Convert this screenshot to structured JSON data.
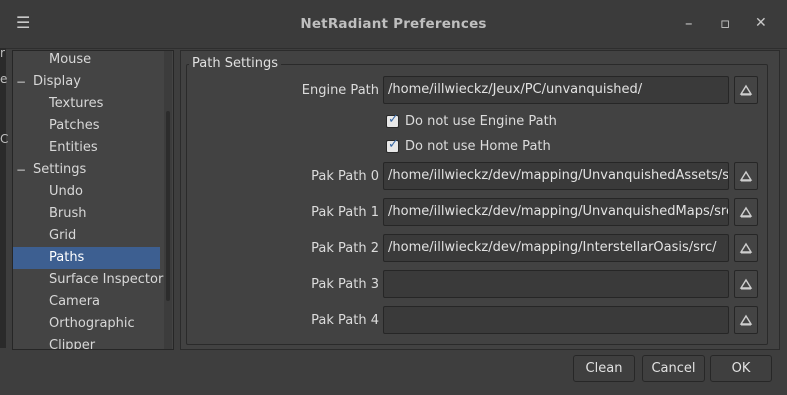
{
  "window": {
    "title": "NetRadiant Preferences",
    "icons": {
      "menu": "menu-icon",
      "minimize": "minimize-icon",
      "maximize": "maximize-icon",
      "close": "close-icon"
    }
  },
  "tree": {
    "items": [
      {
        "label": "Mouse",
        "level": "child"
      },
      {
        "label": "Display",
        "level": "parent",
        "expander": "−"
      },
      {
        "label": "Textures",
        "level": "child"
      },
      {
        "label": "Patches",
        "level": "child"
      },
      {
        "label": "Entities",
        "level": "child"
      },
      {
        "label": "Settings",
        "level": "parent",
        "expander": "−"
      },
      {
        "label": "Undo",
        "level": "child"
      },
      {
        "label": "Brush",
        "level": "child"
      },
      {
        "label": "Grid",
        "level": "child"
      },
      {
        "label": "Paths",
        "level": "child",
        "selected": true
      },
      {
        "label": "Surface Inspector",
        "level": "child"
      },
      {
        "label": "Camera",
        "level": "child"
      },
      {
        "label": "Orthographic",
        "level": "child"
      },
      {
        "label": "Clipper",
        "level": "child"
      }
    ],
    "selected_color": "#3d5f91"
  },
  "path_settings": {
    "legend": "Path Settings",
    "engine_path": {
      "label": "Engine Path",
      "value": "/home/illwieckz/Jeux/PC/unvanquished/"
    },
    "checkboxes": [
      {
        "label": "Do not use Engine Path",
        "checked": true
      },
      {
        "label": "Do not use Home Path",
        "checked": true
      }
    ],
    "pak_paths": [
      {
        "label": "Pak Path 0",
        "value": "/home/illwieckz/dev/mapping/UnvanquishedAssets/src/"
      },
      {
        "label": "Pak Path 1",
        "value": "/home/illwieckz/dev/mapping/UnvanquishedMaps/src/"
      },
      {
        "label": "Pak Path 2",
        "value": "/home/illwieckz/dev/mapping/InterstellarOasis/src/"
      },
      {
        "label": "Pak Path 3",
        "value": ""
      },
      {
        "label": "Pak Path 4",
        "value": ""
      }
    ],
    "browse_icon": "folder-browse-icon"
  },
  "buttons": {
    "clean": "Clean",
    "cancel": "Cancel",
    "ok": "OK"
  },
  "background_strip": {
    "glyphs": [
      "r",
      "e",
      "C"
    ]
  }
}
